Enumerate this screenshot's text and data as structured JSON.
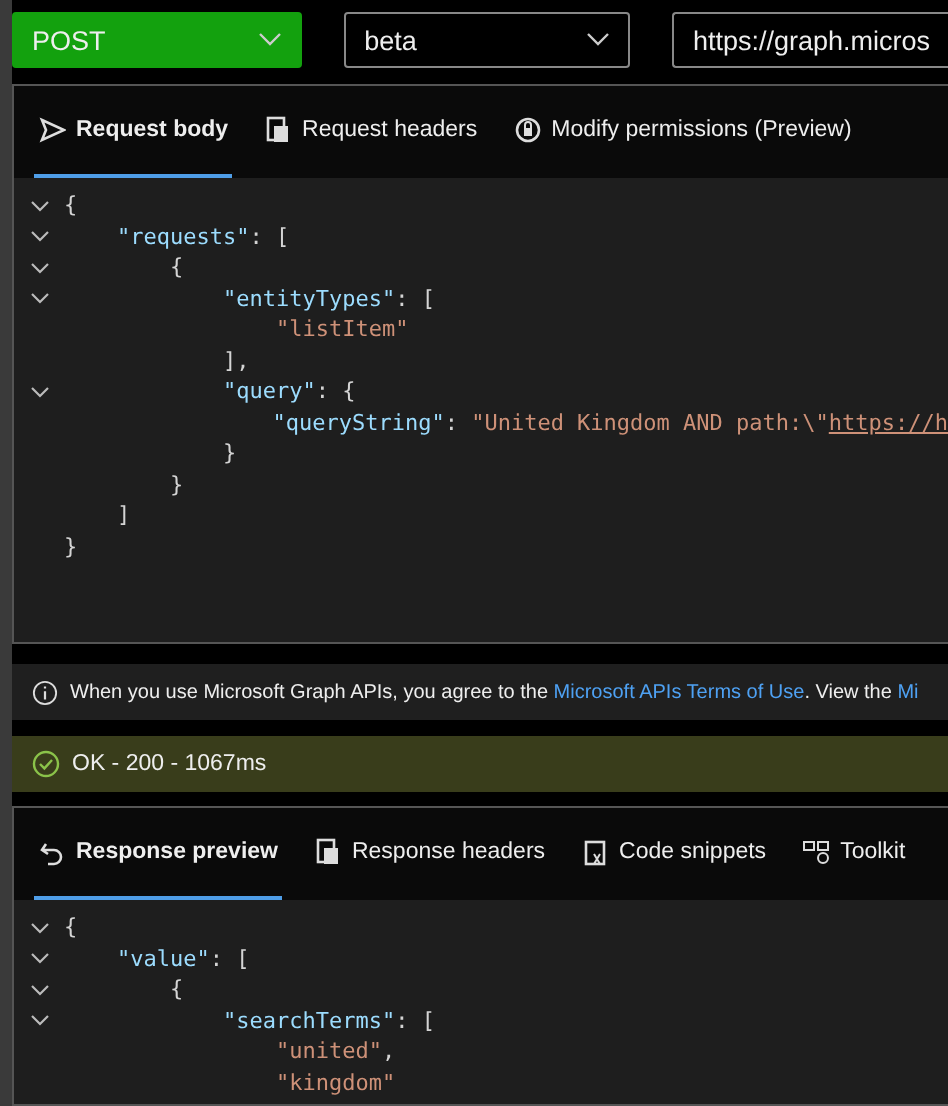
{
  "toolbar": {
    "method": {
      "value": "POST"
    },
    "version": {
      "value": "beta"
    },
    "url": {
      "value": "https://graph.micros"
    }
  },
  "request": {
    "tabs": [
      {
        "label": "Request body",
        "selected": true
      },
      {
        "label": "Request headers",
        "selected": false
      },
      {
        "label": "Modify permissions (Preview)",
        "selected": false
      }
    ],
    "lines": [
      {
        "expanded": true,
        "tokens": [
          {
            "kind": "punct",
            "text": "{"
          }
        ]
      },
      {
        "expanded": true,
        "tokens": [
          {
            "kind": "key",
            "text": "    \"requests\""
          },
          {
            "kind": "punct",
            "text": ": ["
          }
        ]
      },
      {
        "expanded": true,
        "tokens": [
          {
            "kind": "punct",
            "text": "        {"
          }
        ]
      },
      {
        "expanded": true,
        "tokens": [
          {
            "kind": "key",
            "text": "            \"entityTypes\""
          },
          {
            "kind": "punct",
            "text": ": ["
          }
        ]
      },
      {
        "tokens": [
          {
            "kind": "string",
            "text": "                \"listItem\""
          }
        ]
      },
      {
        "tokens": [
          {
            "kind": "punct",
            "text": "            ],"
          }
        ]
      },
      {
        "expanded": true,
        "tokens": [
          {
            "kind": "key",
            "text": "            \"query\""
          },
          {
            "kind": "punct",
            "text": ": {"
          }
        ]
      },
      {
        "tokens": [
          {
            "kind": "key",
            "text": "                \"queryString\""
          },
          {
            "kind": "punct",
            "text": ": "
          },
          {
            "kind": "string",
            "text": "\"United Kingdom AND path:\\\""
          },
          {
            "kind": "link",
            "text": "https://h"
          }
        ]
      },
      {
        "tokens": [
          {
            "kind": "punct",
            "text": "            }"
          }
        ]
      },
      {
        "tokens": [
          {
            "kind": "punct",
            "text": "        }"
          }
        ]
      },
      {
        "tokens": [
          {
            "kind": "punct",
            "text": "    ]"
          }
        ]
      },
      {
        "tokens": [
          {
            "kind": "punct",
            "text": "}"
          }
        ]
      }
    ]
  },
  "notice": {
    "text": "When you use Microsoft Graph APIs, you agree to the ",
    "link": "Microsoft APIs Terms of Use",
    "after": ". View the ",
    "link_2": "Mi"
  },
  "status": {
    "kind": "success",
    "text": "OK - 200 - 1067ms"
  },
  "response": {
    "tabs": [
      {
        "label": "Response preview",
        "selected": true
      },
      {
        "label": "Response headers",
        "selected": false
      },
      {
        "label": "Code snippets",
        "selected": false
      },
      {
        "label": "Toolkit",
        "selected": false
      }
    ],
    "lines": [
      {
        "expanded": true,
        "tokens": [
          {
            "kind": "punct",
            "text": "{"
          }
        ]
      },
      {
        "expanded": true,
        "tokens": [
          {
            "kind": "key",
            "text": "    \"value\""
          },
          {
            "kind": "punct",
            "text": ": ["
          }
        ]
      },
      {
        "expanded": true,
        "tokens": [
          {
            "kind": "punct",
            "text": "        {"
          }
        ]
      },
      {
        "expanded": true,
        "tokens": [
          {
            "kind": "key",
            "text": "            \"searchTerms\""
          },
          {
            "kind": "punct",
            "text": ": ["
          }
        ]
      },
      {
        "tokens": [
          {
            "kind": "string",
            "text": "                \"united\""
          },
          {
            "kind": "punct",
            "text": ","
          }
        ]
      },
      {
        "tokens": [
          {
            "kind": "string",
            "text": "                \"kingdom\""
          }
        ]
      }
    ]
  }
}
